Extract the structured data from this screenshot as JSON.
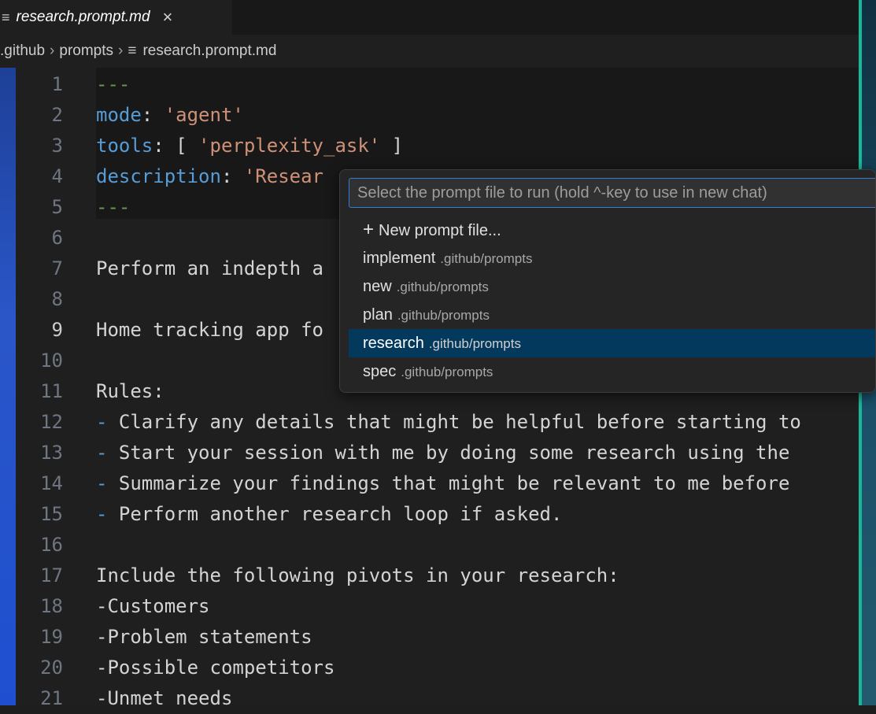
{
  "tab": {
    "title": "research.prompt.md",
    "file_icon": "≡",
    "close": "×"
  },
  "breadcrumb": [
    ".github",
    "prompts",
    "research.prompt.md"
  ],
  "editor": {
    "active_line": 9,
    "lines": [
      {
        "n": 1,
        "parts": [
          [
            "d",
            "---"
          ]
        ]
      },
      {
        "n": 2,
        "parts": [
          [
            "k",
            "mode"
          ],
          [
            "p",
            ": "
          ],
          [
            "s",
            "'agent'"
          ]
        ]
      },
      {
        "n": 3,
        "parts": [
          [
            "k",
            "tools"
          ],
          [
            "p",
            ": [ "
          ],
          [
            "s",
            "'perplexity_ask'"
          ],
          [
            "p",
            " ]"
          ]
        ]
      },
      {
        "n": 4,
        "parts": [
          [
            "k",
            "description"
          ],
          [
            "p",
            ": "
          ],
          [
            "s",
            "'Resear"
          ]
        ]
      },
      {
        "n": 5,
        "parts": [
          [
            "d",
            "---"
          ]
        ]
      },
      {
        "n": 6,
        "parts": []
      },
      {
        "n": 7,
        "parts": [
          [
            "p",
            "Perform an indepth a"
          ]
        ]
      },
      {
        "n": 8,
        "parts": []
      },
      {
        "n": 9,
        "parts": [
          [
            "p",
            "Home tracking app fo"
          ]
        ]
      },
      {
        "n": 10,
        "parts": []
      },
      {
        "n": 11,
        "parts": [
          [
            "p",
            "Rules:"
          ]
        ]
      },
      {
        "n": 12,
        "parts": [
          [
            "bul",
            "-"
          ],
          [
            "p",
            " Clarify any details that might be helpful before starting to"
          ]
        ]
      },
      {
        "n": 13,
        "parts": [
          [
            "bul",
            "-"
          ],
          [
            "p",
            " Start your session with me by doing some research using the"
          ]
        ]
      },
      {
        "n": 14,
        "parts": [
          [
            "bul",
            "-"
          ],
          [
            "p",
            " Summarize your findings that might be relevant to me before"
          ]
        ]
      },
      {
        "n": 15,
        "parts": [
          [
            "bul",
            "-"
          ],
          [
            "p",
            " Perform another research loop if asked."
          ]
        ]
      },
      {
        "n": 16,
        "parts": []
      },
      {
        "n": 17,
        "parts": [
          [
            "p",
            "Include the following pivots in your research:"
          ]
        ]
      },
      {
        "n": 18,
        "parts": [
          [
            "p",
            "-Customers"
          ]
        ]
      },
      {
        "n": 19,
        "parts": [
          [
            "p",
            "-Problem statements"
          ]
        ]
      },
      {
        "n": 20,
        "parts": [
          [
            "p",
            "-Possible competitors"
          ]
        ]
      },
      {
        "n": 21,
        "parts": [
          [
            "p",
            "-Unmet needs"
          ]
        ]
      }
    ]
  },
  "palette": {
    "placeholder": "Select the prompt file to run (hold ^-key to use in new chat)",
    "new_item": {
      "icon": "+",
      "label": "New prompt file..."
    },
    "items": [
      {
        "label": "implement",
        "desc": ".github/prompts",
        "selected": false
      },
      {
        "label": "new",
        "desc": ".github/prompts",
        "selected": false
      },
      {
        "label": "plan",
        "desc": ".github/prompts",
        "selected": false
      },
      {
        "label": "research",
        "desc": ".github/prompts",
        "selected": true
      },
      {
        "label": "spec",
        "desc": ".github/prompts",
        "selected": false
      }
    ]
  }
}
